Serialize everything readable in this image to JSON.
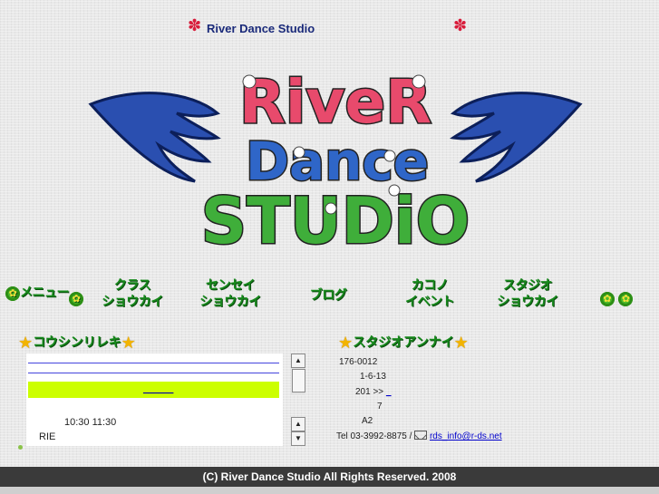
{
  "header": {
    "site_title": "River Dance Studio"
  },
  "logo": {
    "line1": "RiveR",
    "line2": "Dance",
    "line3": "STUDiO"
  },
  "nav": {
    "menu_label": "メニュー",
    "items": [
      {
        "line1": "クラス",
        "line2": "ショウカイ"
      },
      {
        "line1": "センセイ",
        "line2": "ショウカイ"
      },
      {
        "line1": "ブログ",
        "line2": ""
      },
      {
        "line1": "カコノ",
        "line2": "イベント"
      },
      {
        "line1": "スタジオ",
        "line2": "ショウカイ"
      }
    ]
  },
  "schedule": {
    "heading": "コウシンリレキ",
    "link_text": "______",
    "time": "10:30 11:30",
    "instructor": "RIE"
  },
  "access": {
    "heading": "スタジオアンナイ",
    "postal": "176-0012",
    "address1": "1-6-13",
    "address2": "201 >>",
    "address2_link": "_",
    "line7": "7",
    "line8": "A2",
    "tel": "Tel 03-3992-8875 /",
    "email": "rds_info@r-ds.net"
  },
  "footer": {
    "copyright": "(C) River Dance Studio All Rights Reserved. 2008"
  }
}
